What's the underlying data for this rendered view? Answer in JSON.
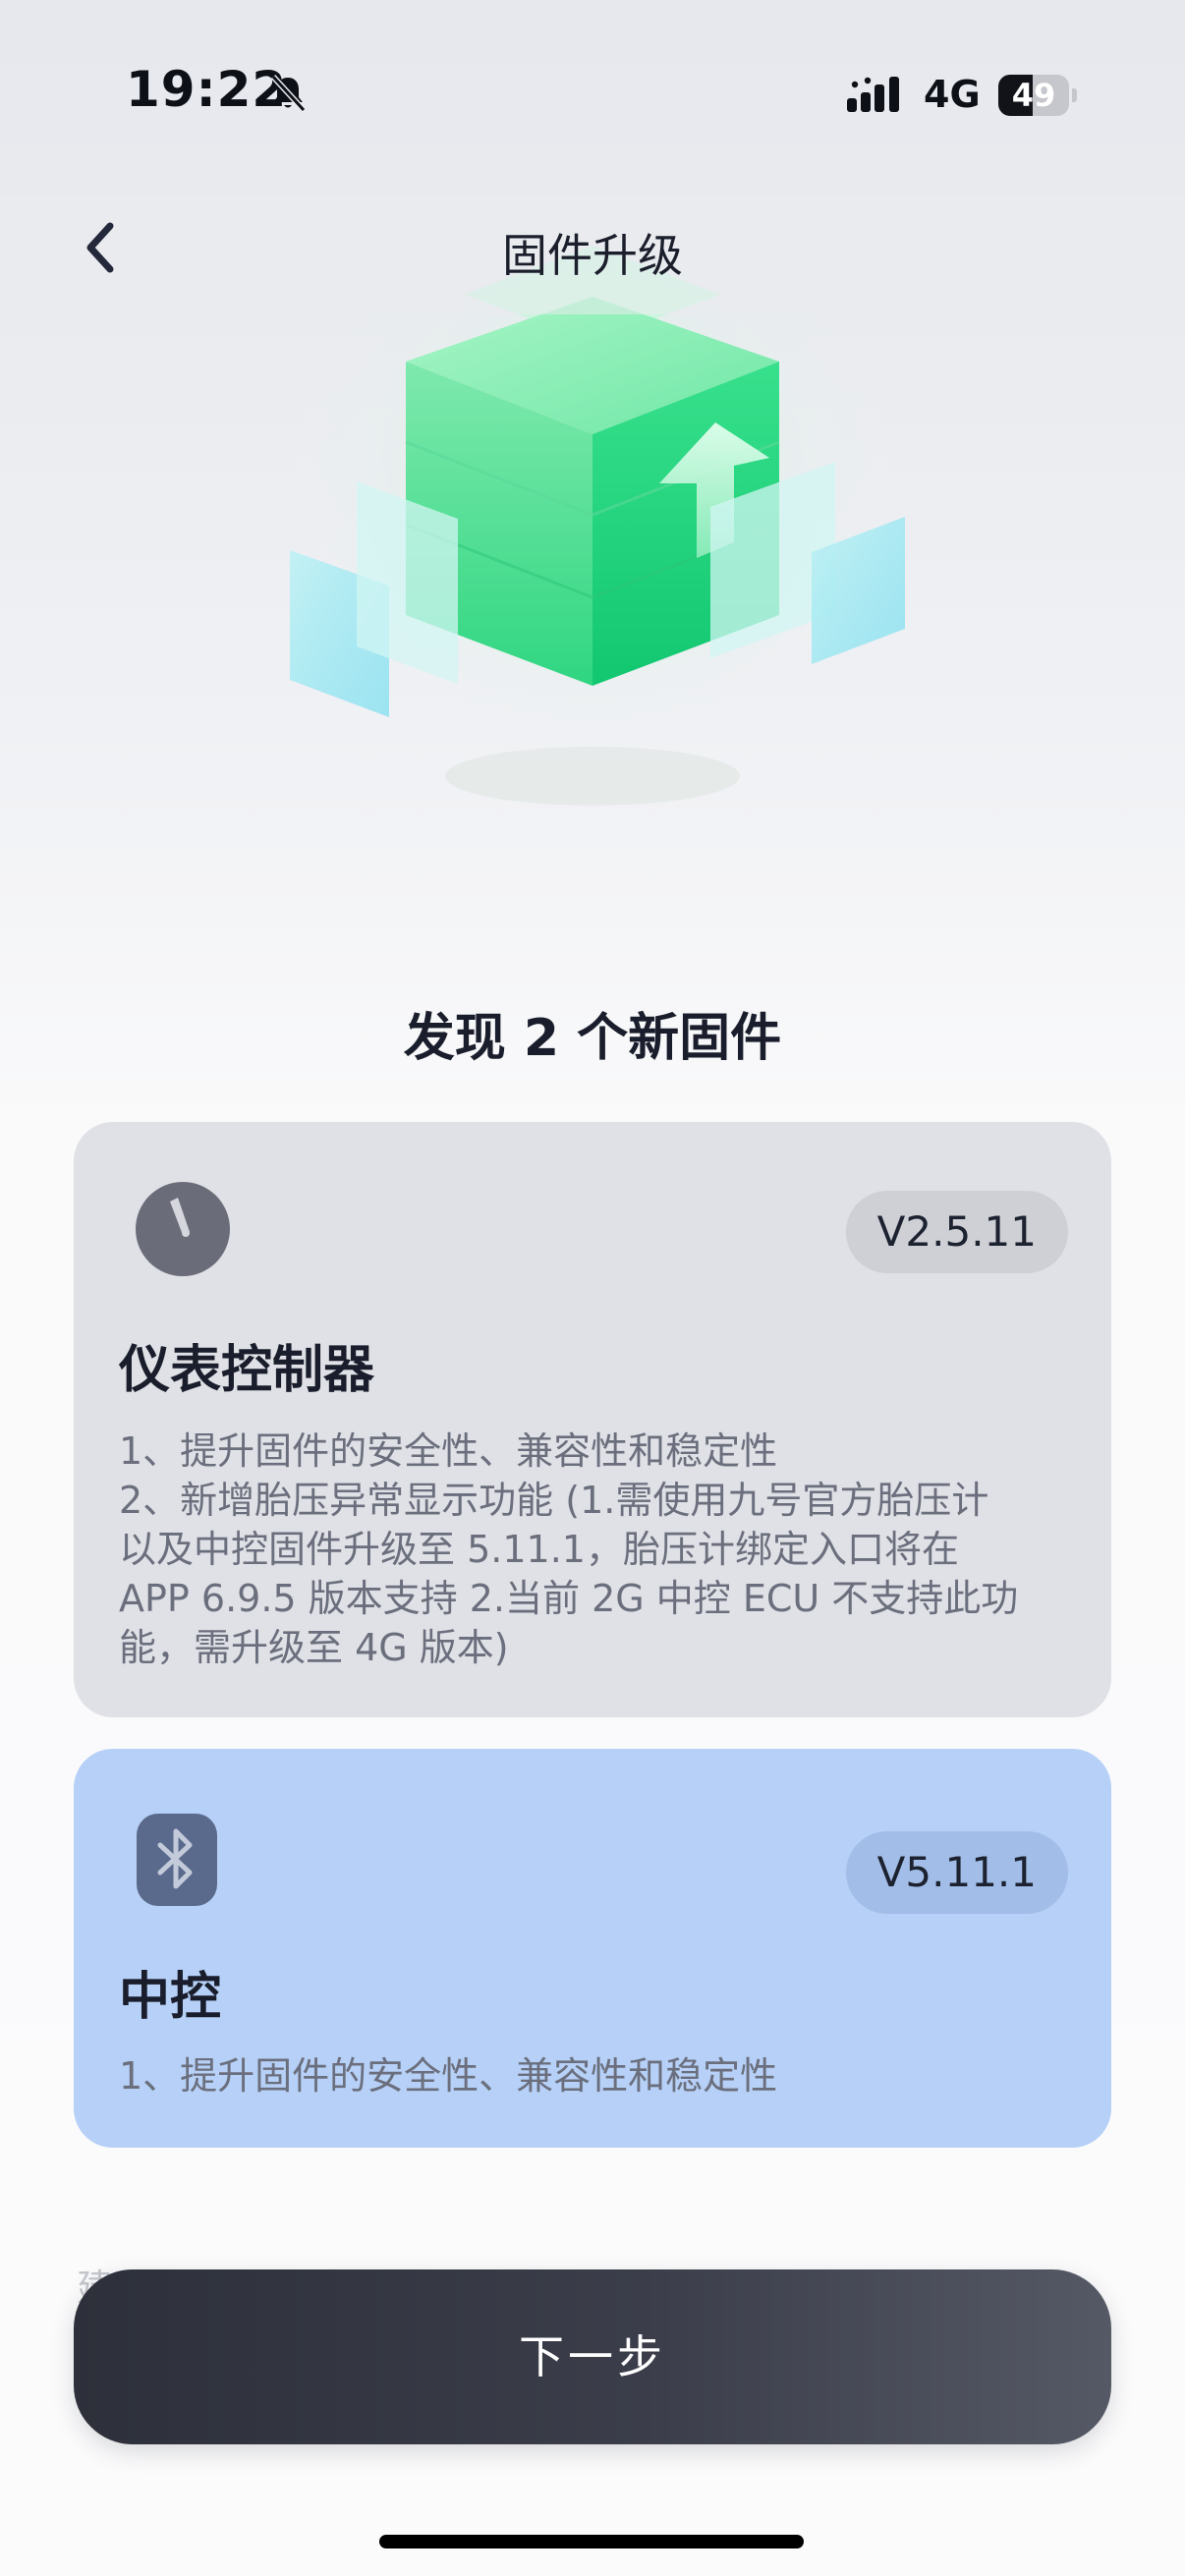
{
  "status_bar": {
    "time": "19:22",
    "network": "4G",
    "battery": "49",
    "battery_level": 0.49,
    "mute_icon": "bell-slash-icon",
    "signal_icon": "cellular-signal-icon"
  },
  "nav": {
    "back_icon": "chevron-left-icon",
    "title": "固件升级"
  },
  "hero": {
    "illustration": "firmware-upgrade-cube-illustration",
    "accent_color": "#3ddc8c"
  },
  "headline": "发现 2 个新固件",
  "firmwares": [
    {
      "icon": "gauge-dial-icon",
      "version": "V2.5.11",
      "name": "仪表控制器",
      "notes": [
        "1、提升固件的安全性、兼容性和稳定性",
        "2、新增胎压异常显示功能 (1.需使用九号官方胎压计",
        "以及中控固件升级至 5.11.1，胎压计绑定入口将在",
        "APP 6.9.5 版本支持 2.当前 2G 中控 ECU 不支持此功",
        "能，需升级至 4G 版本)"
      ],
      "selected": false,
      "color": "#e0e1e6"
    },
    {
      "icon": "bluetooth-icon",
      "version": "V5.11.1",
      "name": "中控",
      "notes": [
        "1、提升固件的安全性、兼容性和稳定性"
      ],
      "selected": true,
      "color": "#b6d0f7"
    }
  ],
  "faded_text": "建",
  "next_button": "下一步"
}
